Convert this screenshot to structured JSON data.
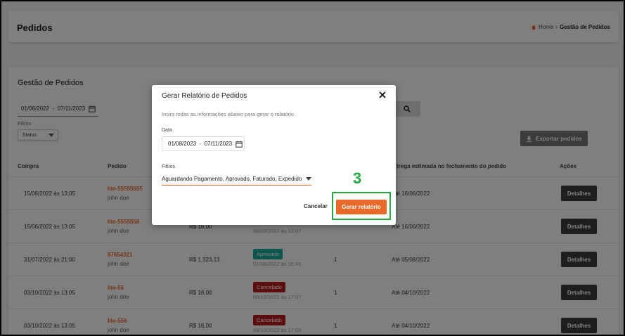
{
  "header": {
    "title": "Pedidos",
    "breadcrumb": {
      "home": "Home",
      "separator": "›",
      "current": "Gestão de Pedidos"
    }
  },
  "section_title": "Gestão de Pedidos",
  "filters": {
    "date_range": "01/06/2022  -  07/11/2023",
    "label": "Filtros",
    "status_value": "Status"
  },
  "export_label": "Exportar pedidos",
  "table": {
    "headers": [
      "Compra",
      "Pedido",
      "",
      "",
      "",
      "Data estimada de entrega estimada no fechamento do pedido",
      "Ações"
    ],
    "visible_headers": {
      "compra": "Compra",
      "pedido": "Pedido",
      "entrega": "trega estimada no fechamento do pedido",
      "acoes": "Ações"
    },
    "rows": [
      {
        "compra": "15/06/2022 às 13:05",
        "pedido": "lite-55555555",
        "cliente": "john doe",
        "valor": "",
        "status": "",
        "status_date": "",
        "qtd": "",
        "entrega": "Até 16/06/2022",
        "acao": "Detalhes"
      },
      {
        "compra": "15/06/2022 às 13:05",
        "pedido": "lite-5555558",
        "cliente": "john doe",
        "valor": "R$ 16,00",
        "status": "",
        "status_date": "08/09/2022 às 12:07",
        "qtd": "",
        "entrega": "Até 16/06/2022",
        "acao": "Detalhes"
      },
      {
        "compra": "31/07/2022 às 21:00",
        "pedido": "87654321",
        "cliente": "john doe",
        "valor": "R$ 1.323,13",
        "status": "Aprovado",
        "status_date": "01/08/2022 às 16:45",
        "qtd": "1",
        "entrega": "Até 05/08/2022",
        "acao": "Detalhes"
      },
      {
        "compra": "03/10/2022 às 13:05",
        "pedido": "lite-56",
        "cliente": "john doe",
        "valor": "R$ 16,00",
        "status": "Cancelado",
        "status_date": "03/10/2022 às 17:07",
        "qtd": "1",
        "entrega": "Até 04/10/2022",
        "acao": "Detalhes"
      },
      {
        "compra": "03/10/2022 às 13:05",
        "pedido": "lite-556",
        "cliente": "john doe",
        "valor": "R$ 16,00",
        "status": "Cancelado",
        "status_date": "03/10/2022 às 17:06",
        "qtd": "1",
        "entrega": "Até 04/10/2022",
        "acao": "Detalhes"
      }
    ]
  },
  "modal": {
    "title": "Gerar Relatório de Pedidos",
    "subtitle": "Insira todas as informações abaixo para gerar o relatório.",
    "date_label": "Data",
    "date_range": "01/08/2023  -  07/11/2023",
    "filters_label": "Filtros",
    "filters_value": "Aguardando Pagamento, Aprovado, Faturado, Expedido",
    "cancel_label": "Cancelar",
    "generate_label": "Gerar relatório"
  },
  "annotation": {
    "step": "3"
  },
  "colors": {
    "accent": "#e8692a",
    "approved": "#1aaa9a",
    "cancelled": "#b81c1c",
    "highlight": "#23a844",
    "action": "#3d3d3d"
  },
  "icons": [
    "home-icon",
    "calendar-icon",
    "search-icon",
    "download-icon",
    "close-icon",
    "chevron-down-icon"
  ]
}
